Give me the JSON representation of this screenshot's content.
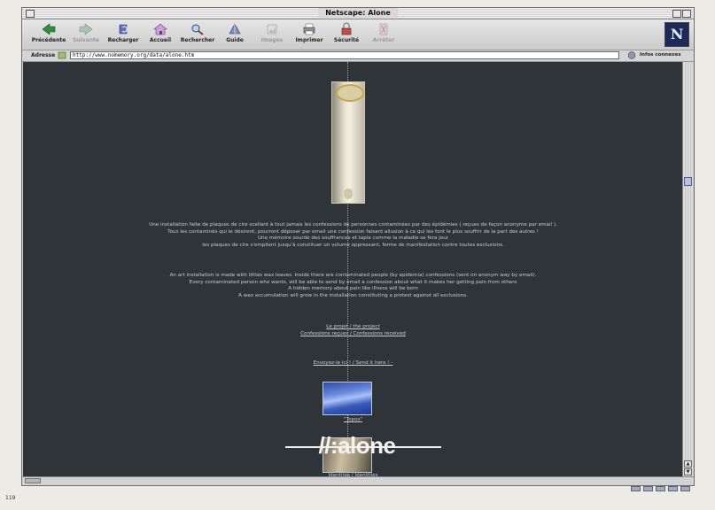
{
  "window": {
    "title": "Netscape: Alone"
  },
  "toolbar": {
    "buttons": [
      {
        "label": "Précédente",
        "icon": "back-arrow-icon",
        "enabled": true
      },
      {
        "label": "Suivante",
        "icon": "forward-arrow-icon",
        "enabled": false
      },
      {
        "label": "Recharger",
        "icon": "reload-icon",
        "enabled": true
      },
      {
        "label": "Accueil",
        "icon": "home-icon",
        "enabled": true
      },
      {
        "label": "Rechercher",
        "icon": "search-icon",
        "enabled": true
      },
      {
        "label": "Guide",
        "icon": "guide-icon",
        "enabled": true
      },
      {
        "label": "Images",
        "icon": "images-icon",
        "enabled": false
      },
      {
        "label": "Imprimer",
        "icon": "print-icon",
        "enabled": true
      },
      {
        "label": "Sécurité",
        "icon": "security-icon",
        "enabled": true
      },
      {
        "label": "Arrêter",
        "icon": "stop-icon",
        "enabled": false
      }
    ],
    "logo_letter": "N"
  },
  "location": {
    "label": "Adresse",
    "url": "http://www.nomemory.org/data/alone.htm",
    "related_label": "Infos connexes"
  },
  "content": {
    "french": [
      "Une installation faite de plaques de cire scellant à tout jamais les confessions de personnes contaminées par des épidémies ( reçues de façon anonyme par email ).",
      "Tous les contaminés qui le désirent, pourront déposer par email une confession faisant allusion à ce qui les font le plus souffrir de la part des autres !",
      "Une mémoire sourde des souffrances et tapie comme la maladie se fera jour",
      "les plaques de cire s'empilent jusqu'à constituer un volume oppressant, forme de manifestation contre toutes exclusions."
    ],
    "english": [
      "An art installation is made with littles wax leaves. Inside there are contaminated people (by epidemia) confessions (sent on anonym way by email).",
      "Every contaminated person who wants, will be able to send by email a confession about what it makes her getting pain from others",
      "A hidden memory about pain like illness will be born",
      "A wax accumulation will grow in the installation constituting a protest against all exclusions."
    ],
    "link_project": "Le projet / the project",
    "link_confessions": "Confessions reçues / Confessions received",
    "link_send": "Envoyez-le ici ! / Send it here ! -",
    "link_topos": "\"Topos\"",
    "logo_text": "//:alone",
    "link_identites": "Identités / Identities"
  },
  "page_number": "119",
  "colors": {
    "content_bg": "#2f3438",
    "text": "#c7cdd3",
    "chrome": "#d6d6d6"
  }
}
